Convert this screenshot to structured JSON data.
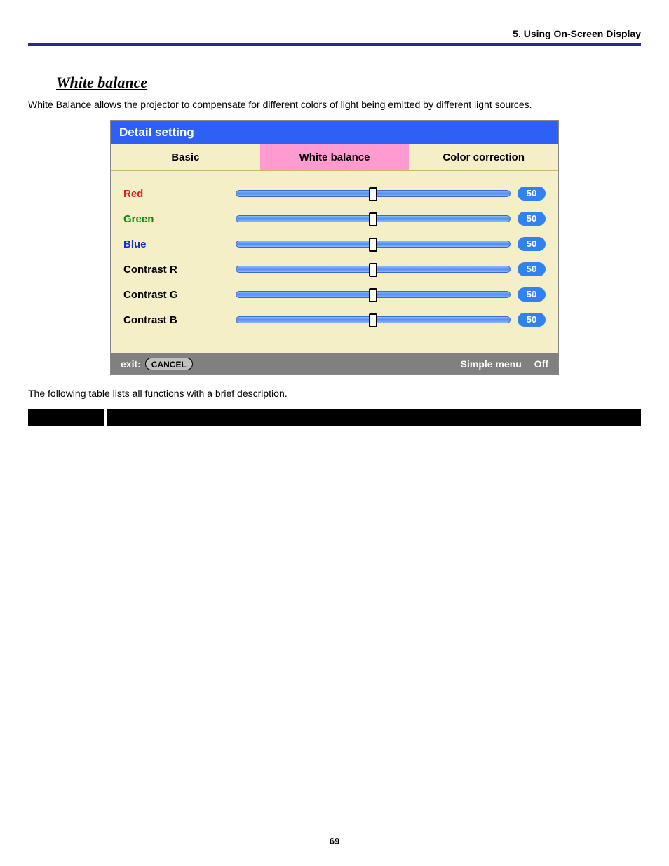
{
  "header": {
    "chapter": "5. Using On-Screen Display"
  },
  "section": {
    "title": "White balance",
    "intro": "White Balance allows the projector to compensate for different colors of light being emitted by different light sources."
  },
  "osd": {
    "title": "Detail setting",
    "tabs": {
      "basic": "Basic",
      "white_balance": "White balance",
      "color_correction": "Color correction"
    },
    "rows": [
      {
        "label": "Red",
        "cls": "lbl-red",
        "value": "50"
      },
      {
        "label": "Green",
        "cls": "lbl-green",
        "value": "50"
      },
      {
        "label": "Blue",
        "cls": "lbl-blue",
        "value": "50"
      },
      {
        "label": "Contrast R",
        "cls": "lbl-black",
        "value": "50"
      },
      {
        "label": "Contrast G",
        "cls": "lbl-black",
        "value": "50"
      },
      {
        "label": "Contrast B",
        "cls": "lbl-black",
        "value": "50"
      }
    ],
    "footer": {
      "exit_label": "exit:",
      "exit_button": "CANCEL",
      "simple_menu_label": "Simple menu",
      "simple_menu_value": "Off"
    }
  },
  "post_text": "The following table lists all functions with a brief description.",
  "table_headers": {
    "col1": "",
    "col2": ""
  },
  "page_number": "69"
}
